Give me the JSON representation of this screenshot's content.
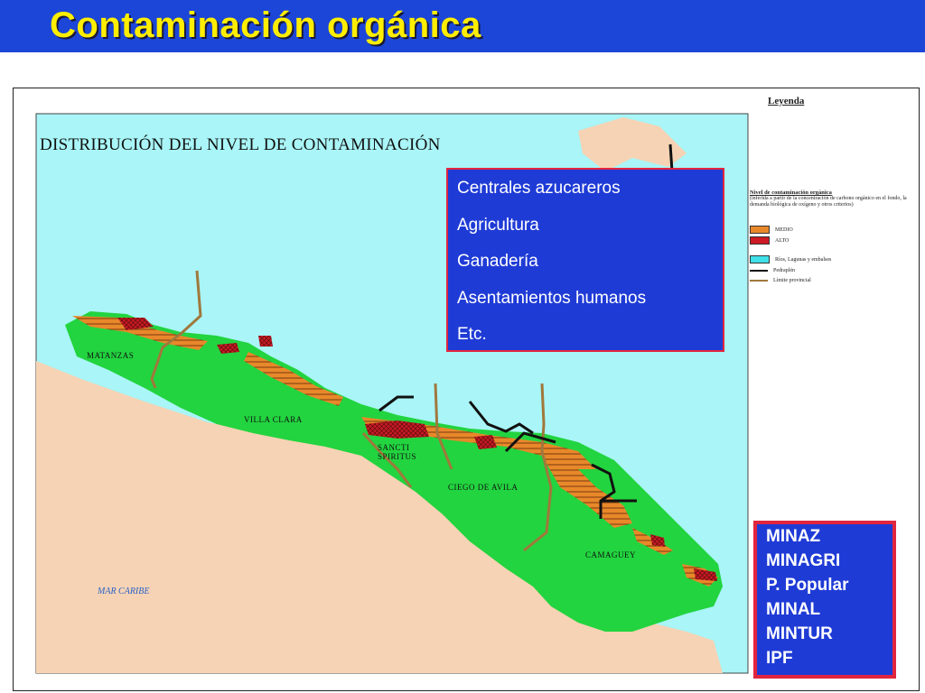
{
  "header": {
    "title": "Contaminación orgánica"
  },
  "map": {
    "title": "DISTRIBUCIÓN DEL NIVEL DE CONTAMINACIÓN",
    "provinces": [
      "MATANZAS",
      "VILLA CLARA",
      "SANCTI SPIRITUS",
      "CIEGO DE AVILA",
      "CAMAGUEY"
    ],
    "sea_label": "MAR CARIBE",
    "colors": {
      "sea": "#a9f5f7",
      "land": "#22d43f",
      "foreign_land": "#f6d3b4",
      "medium": "#e8882a",
      "high": "#cc1b24",
      "boundary": "#a0783c",
      "roads": "#111111"
    }
  },
  "legend": {
    "title": "Leyenda",
    "heading": "Nivel de contaminación orgánica",
    "description": "(inferida a partir de la concentración de carbono orgánico en el fondo, la demanda biológica de oxígeno y otros criterios)",
    "items": [
      {
        "label": "MEDIO",
        "color": "#e8882a"
      },
      {
        "label": "ALTO",
        "color": "#cc1b24"
      },
      {
        "label": "Ríos, Lagunas y embalses",
        "color": "#3fe0e8"
      },
      {
        "label": "Pedraplén",
        "color": "#111111"
      },
      {
        "label": "Límite provincial",
        "color": "#a0783c"
      }
    ]
  },
  "sources": {
    "items": [
      "Centrales azucareros",
      "Agricultura",
      "Ganadería",
      "Asentamientos humanos",
      "Etc."
    ]
  },
  "institutions": {
    "items": [
      "MINAZ",
      "MINAGRI",
      "P. Popular",
      "MINAL",
      "MINTUR",
      "IPF"
    ]
  }
}
